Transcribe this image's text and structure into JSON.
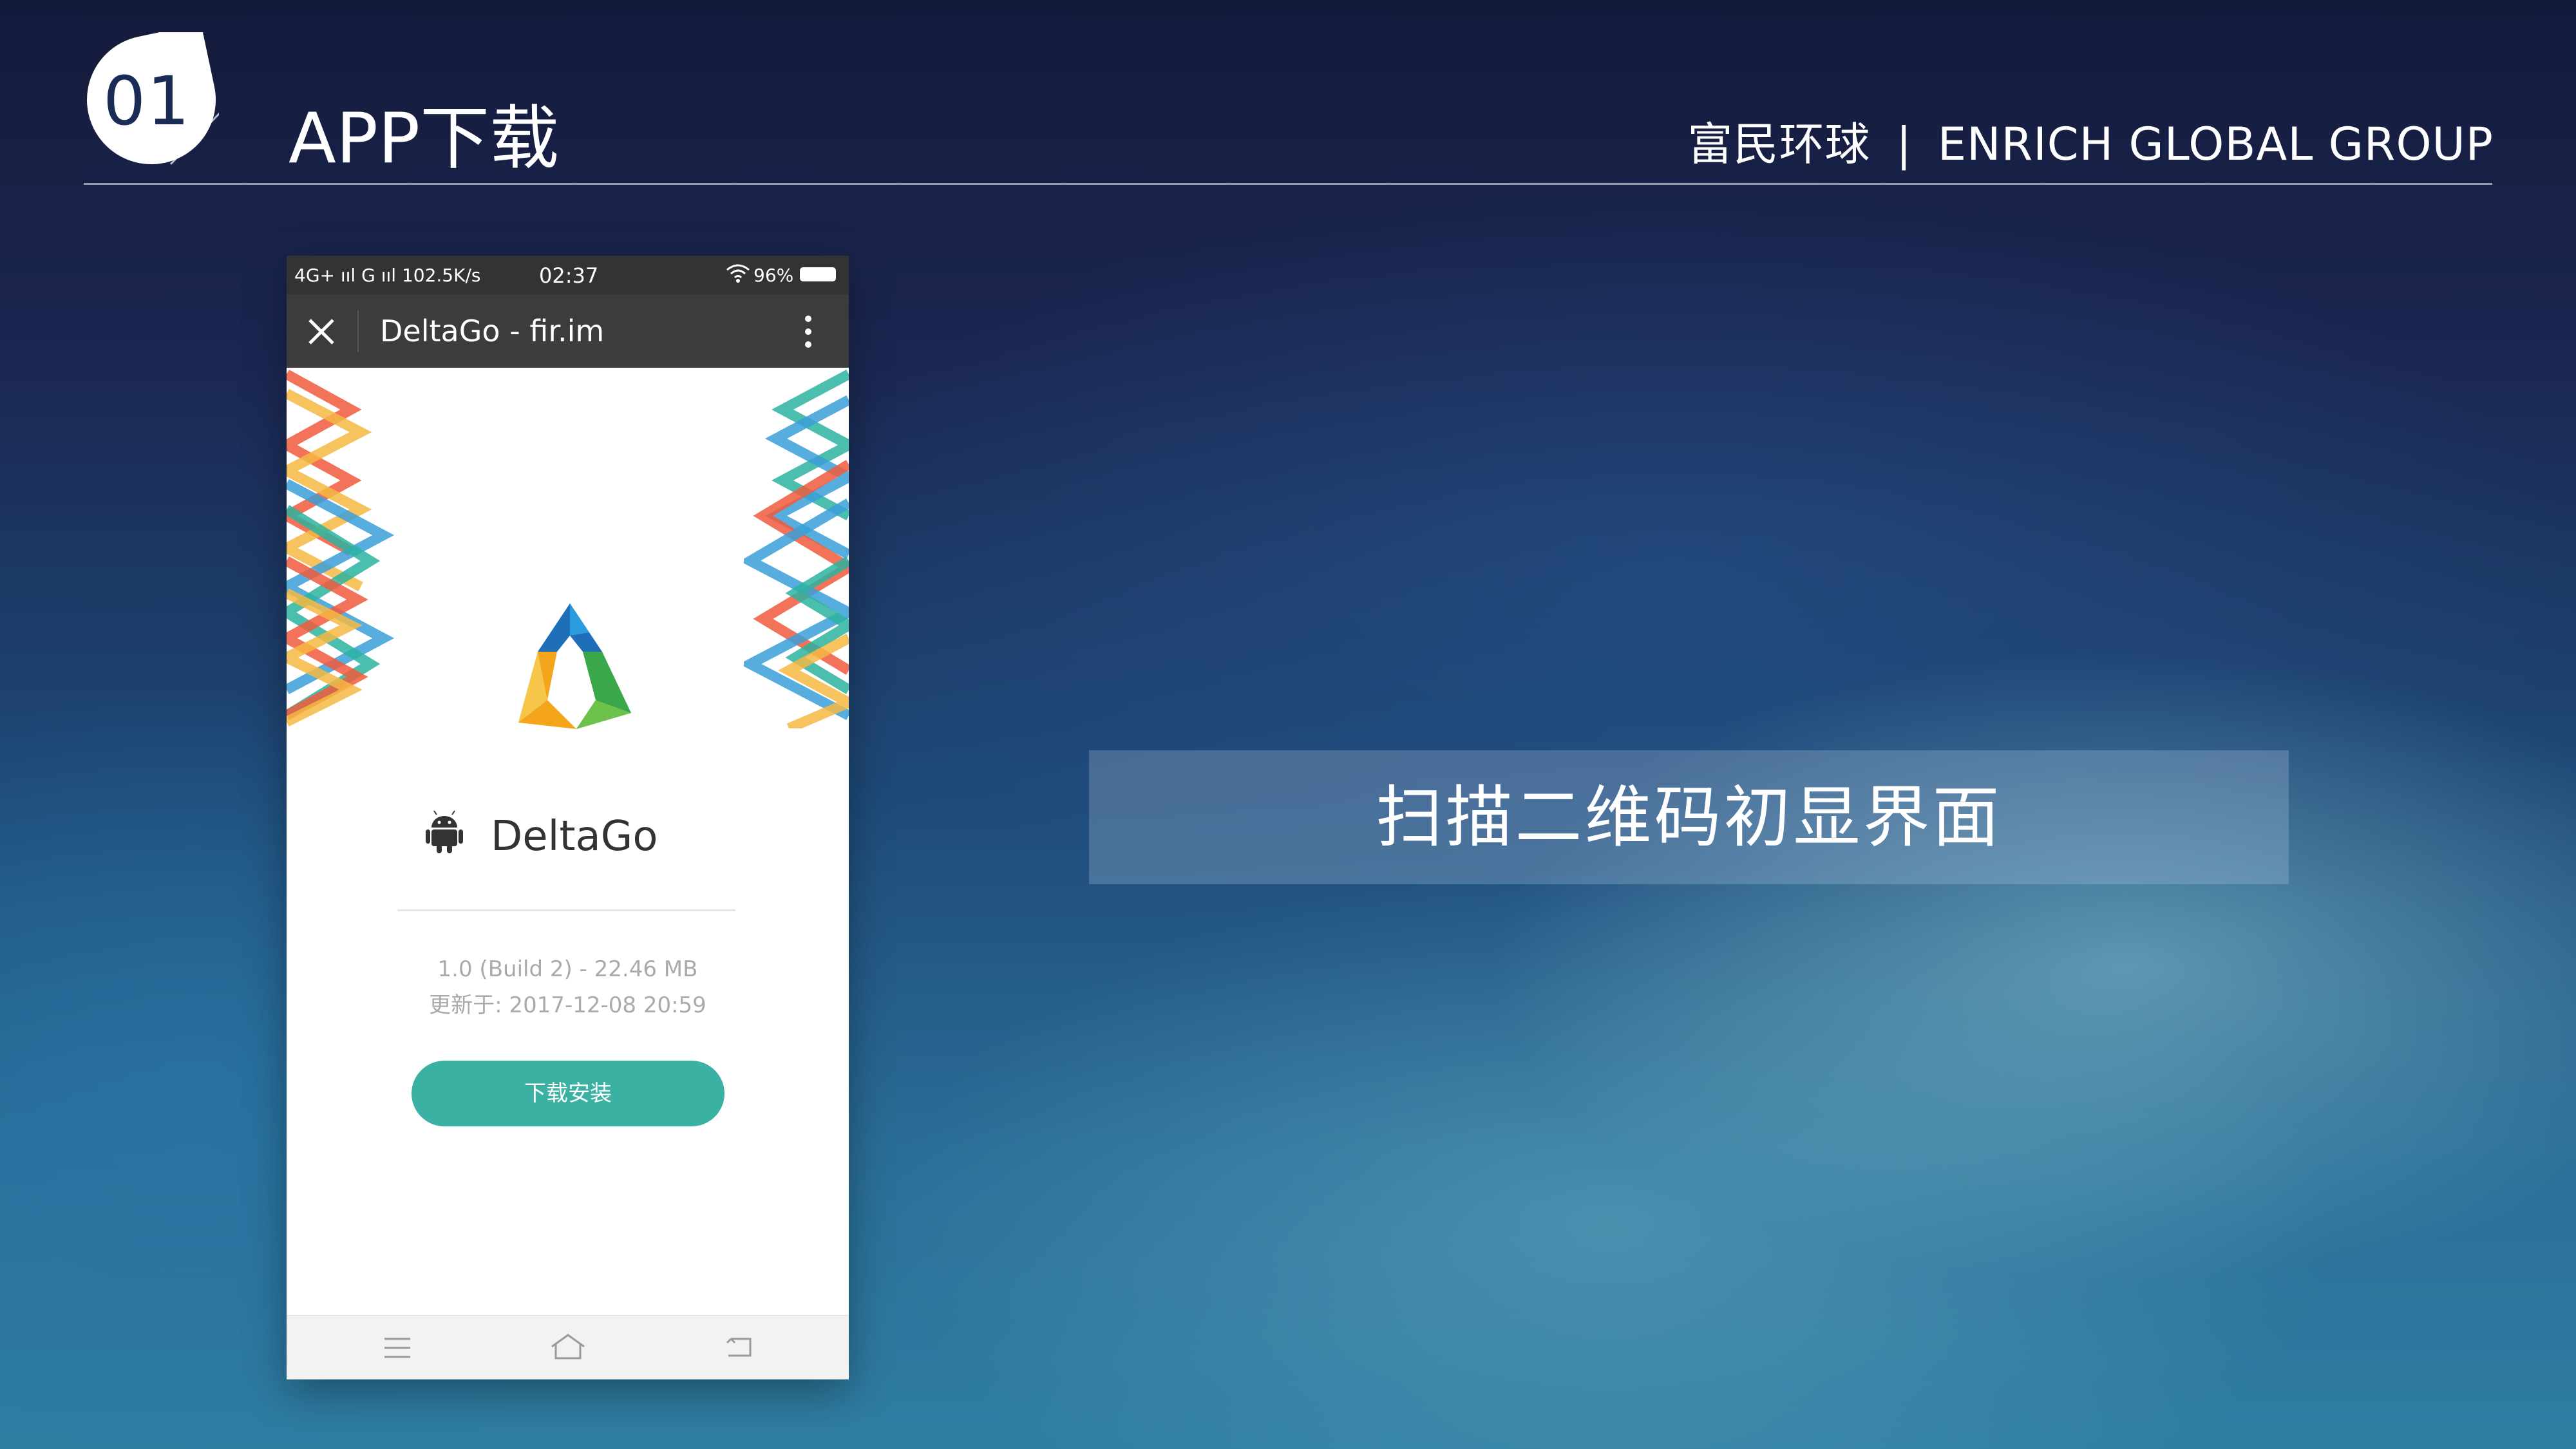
{
  "header": {
    "badge_number": "01",
    "title": "APP下载",
    "brand_cn": "富民环球",
    "brand_separator": "|",
    "brand_en": "ENRICH GLOBAL GROUP"
  },
  "phone": {
    "status_bar": {
      "network": "4G+ ııl G ııl 102.5K/s",
      "time": "02:37",
      "battery": "96%"
    },
    "browser": {
      "title": "DeltaGo - fir.im",
      "icons": [
        "close-icon",
        "more-vertical-icon"
      ]
    },
    "app": {
      "platform_icon": "android-icon",
      "name": "DeltaGo",
      "version": "1.0 (Build 2) - 22.46 MB",
      "updated": "更新于: 2017-12-08 20:59",
      "download_label": "下载安装"
    },
    "nav_icons": [
      "menu-icon",
      "home-icon",
      "back-icon"
    ],
    "colors": {
      "accent": "#3bb1a4",
      "chrome": "#3c3c3c"
    }
  },
  "caption": {
    "text": "扫描二维码初显界面"
  }
}
